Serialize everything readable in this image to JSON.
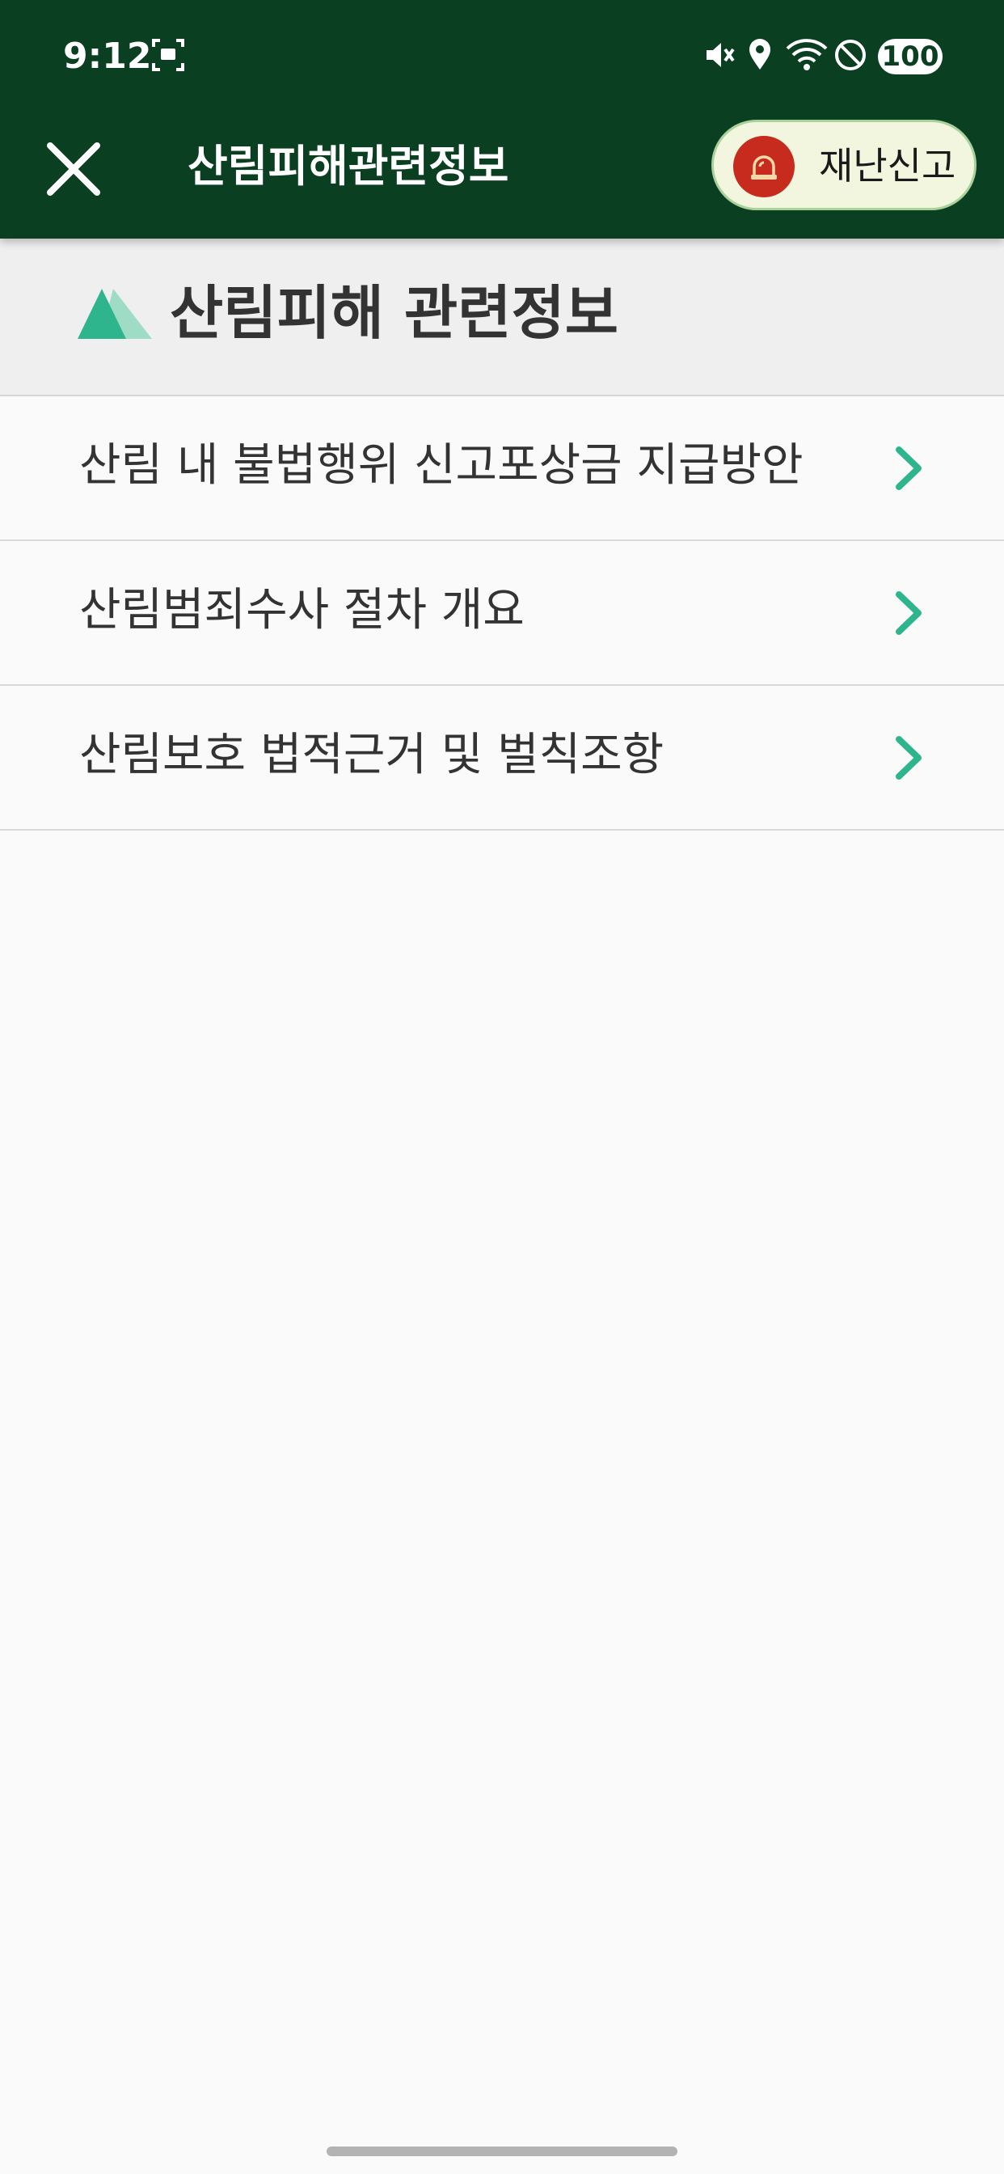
{
  "status_bar": {
    "time": "9:12",
    "battery": "100",
    "icons": [
      "screenshot-icon",
      "mute-icon",
      "location-icon",
      "wifi-icon",
      "do-not-disturb-icon"
    ]
  },
  "app_bar": {
    "title": "산림피해관련정보",
    "close_icon": "close-icon",
    "report_button_label": "재난신고",
    "report_icon": "siren-icon"
  },
  "section": {
    "title": "산림피해 관련정보",
    "icon": "mountain-icon"
  },
  "menu": {
    "items": [
      {
        "label": "산림 내 불법행위 신고포상금 지급방안"
      },
      {
        "label": "산림범죄수사 절차 개요"
      },
      {
        "label": "산림보호 법적근거 및 벌칙조항"
      }
    ]
  },
  "colors": {
    "app_bar_bg": "#0b3f22",
    "accent_green": "#2fb58e",
    "siren_red": "#c62b1d",
    "report_button_bg": "#f3f6df"
  }
}
